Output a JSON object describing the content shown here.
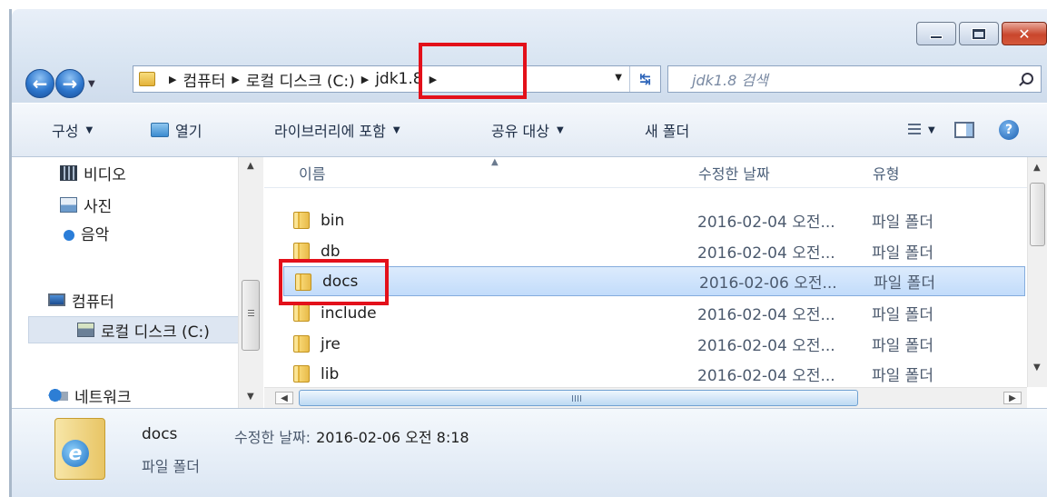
{
  "address": {
    "crumbs": [
      "컴퓨터",
      "로컬 디스크 (C:)",
      "jdk1.8"
    ]
  },
  "search": {
    "placeholder": "jdk1.8 검색"
  },
  "toolbar": {
    "organize": "구성",
    "open": "열기",
    "include_library": "라이브러리에 포함",
    "share": "공유 대상",
    "new_folder": "새 폴더"
  },
  "nav": {
    "items": [
      {
        "label": "비디오",
        "icon": "video-library-icon"
      },
      {
        "label": "사진",
        "icon": "pictures-library-icon"
      },
      {
        "label": "음악",
        "icon": "music-library-icon"
      },
      {
        "label": "컴퓨터",
        "icon": "computer-icon"
      },
      {
        "label": "로컬 디스크 (C:)",
        "icon": "local-disk-icon"
      },
      {
        "label": "네트워크",
        "icon": "network-icon"
      }
    ]
  },
  "columns": {
    "name": "이름",
    "date": "수정한 날짜",
    "type": "유형"
  },
  "files": [
    {
      "name": "bin",
      "date": "2016-02-04 오전...",
      "type": "파일 폴더"
    },
    {
      "name": "db",
      "date": "2016-02-04 오전...",
      "type": "파일 폴더"
    },
    {
      "name": "docs",
      "date": "2016-02-06 오전...",
      "type": "파일 폴더"
    },
    {
      "name": "include",
      "date": "2016-02-04 오전...",
      "type": "파일 폴더"
    },
    {
      "name": "jre",
      "date": "2016-02-04 오전...",
      "type": "파일 폴더"
    },
    {
      "name": "lib",
      "date": "2016-02-04 오전...",
      "type": "파일 폴더"
    }
  ],
  "selected_index": 2,
  "details": {
    "name": "docs",
    "type": "파일 폴더",
    "date_label": "수정한 날짜:",
    "date_value": "2016-02-06 오전 8:18"
  },
  "colors": {
    "highlight": "#e3101a",
    "selection": "#c2dcfb",
    "close_button": "#c9462c"
  }
}
